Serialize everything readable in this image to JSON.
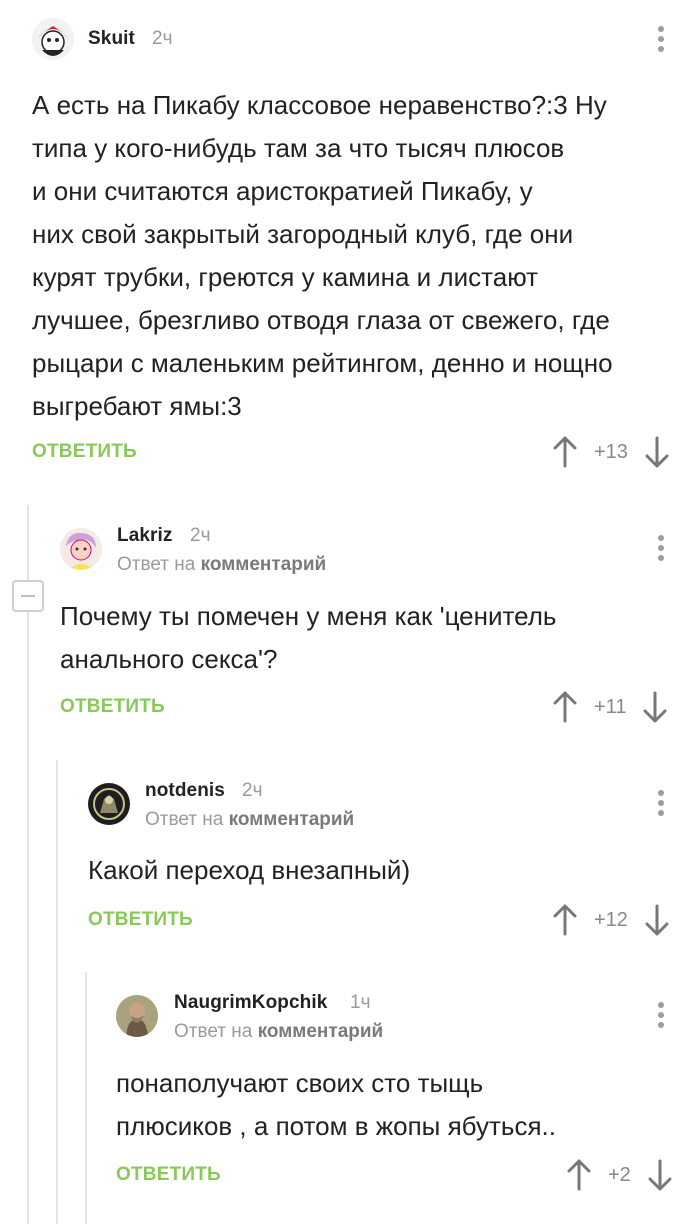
{
  "comments": [
    {
      "author": "Skuit",
      "time": "2ч",
      "text_lines": [
        "А есть на Пикабу классовое неравенство?:3 Ну",
        "типа у кого-нибудь там за что тысяч плюсов",
        "и они считаются аристократией Пикабу, у",
        "них свой закрытый загородный клуб, где они",
        "курят трубки, греются у камина и листают",
        "лучшее, брезгливо отводя глаза от свежего, где",
        "рыцари с маленьким рейтингом, денно и нощно",
        "выгребают ямы:3"
      ],
      "reply_label": "ОТВЕТИТЬ",
      "rating": "+13"
    },
    {
      "author": "Lakriz",
      "time": "2ч",
      "reply_to_prefix": "Ответ на",
      "reply_to_target": "комментарий",
      "text_lines": [
        "Почему ты помечен у меня как 'ценитель",
        "анального секса'?"
      ],
      "reply_label": "ОТВЕТИТЬ",
      "rating": "+11"
    },
    {
      "author": "notdenis",
      "time": "2ч",
      "reply_to_prefix": "Ответ на",
      "reply_to_target": "комментарий",
      "text_lines": [
        "Какой переход внезапный)"
      ],
      "reply_label": "ОТВЕТИТЬ",
      "rating": "+12"
    },
    {
      "author": "NaugrimKopchik",
      "time": "1ч",
      "reply_to_prefix": "Ответ на",
      "reply_to_target": "комментарий",
      "text_lines": [
        "понаполучают своих сто тыщь",
        "плюсиков , а потом в жопы ябуться.."
      ],
      "reply_label": "ОТВЕТИТЬ",
      "rating": "+2"
    }
  ],
  "colors": {
    "reply_green": "#8ac858",
    "muted_gray": "#9a9a9a"
  },
  "icons": [
    "more-vertical-icon",
    "upvote-arrow-icon",
    "downvote-arrow-icon",
    "collapse-icon"
  ]
}
